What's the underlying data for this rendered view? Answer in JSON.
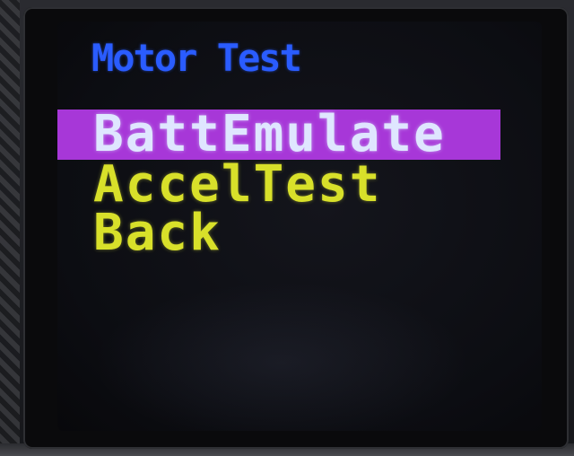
{
  "screen": {
    "title": "Motor Test"
  },
  "menu": {
    "selected_index": 0,
    "items": [
      {
        "label": "BattEmulate"
      },
      {
        "label": "AccelTest"
      },
      {
        "label": "Back"
      }
    ]
  },
  "colors": {
    "title": "#2a5cff",
    "selected_bg": "#a737d8",
    "selected_text": "#dfe6ff",
    "item_text": "#d8e02a",
    "screen_bg": "#0c0d12"
  }
}
